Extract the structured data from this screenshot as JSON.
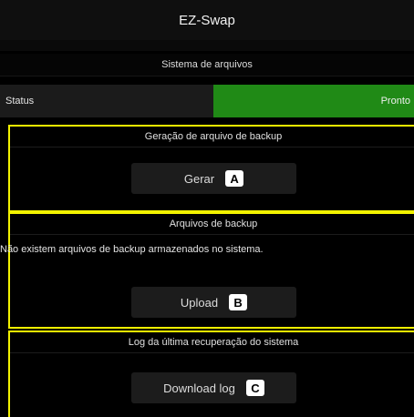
{
  "header": {
    "title": "EZ-Swap"
  },
  "file_system": {
    "title": "Sistema de arquivos",
    "status_label": "Status",
    "status_value": "Pronto",
    "status_color": "#208a16"
  },
  "backup_generation": {
    "title": "Geração de arquivo de backup",
    "button_label": "Gerar",
    "button_tag": "A"
  },
  "backup_files": {
    "title": "Arquivos de backup",
    "message": "Não existem arquivos de backup armazenados no sistema.",
    "button_label": "Upload",
    "button_tag": "B"
  },
  "recovery_log": {
    "title": "Log da última recuperação do sistema",
    "button_label": "Download log",
    "button_tag": "C"
  },
  "colors": {
    "highlight_border": "#f2f200",
    "background": "#000000",
    "button_bg": "#1c1c1c"
  }
}
